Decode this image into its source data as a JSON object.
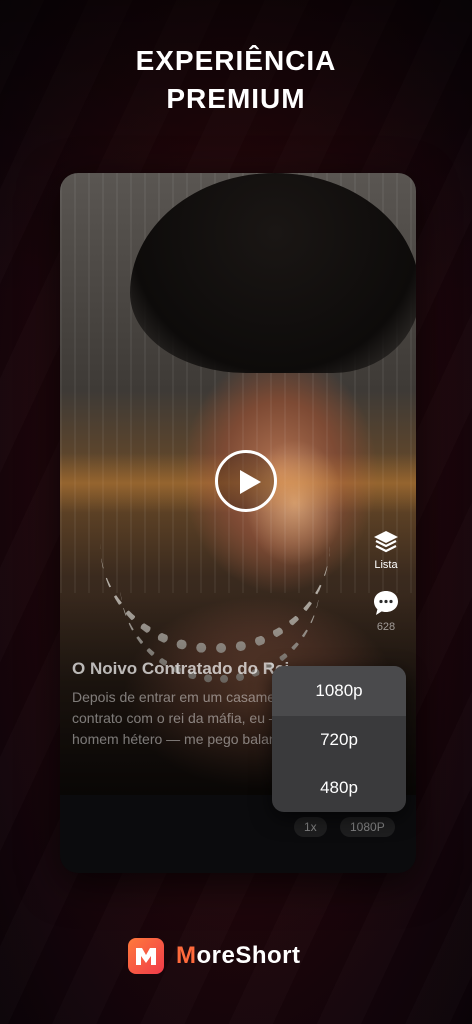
{
  "headline": {
    "line1": "EXPERIÊNCIA",
    "line2": "PREMIUM"
  },
  "player": {
    "play_icon": "play-icon",
    "side_actions": [
      {
        "icon": "layers-icon",
        "label": "Lista"
      },
      {
        "icon": "comment-icon",
        "label": "628"
      }
    ],
    "title": "O Noivo Contratado do Rei",
    "description_lines": [
      "Depois de entrar em um casamento",
      "contrato com o rei da máfia, eu —",
      "homem hétero — me pego balançando"
    ],
    "speed_chip": "1x",
    "quality_chip": "1080P"
  },
  "quality_menu": {
    "options": [
      "1080p",
      "720p",
      "480p"
    ],
    "selected": "1080p"
  },
  "brand": {
    "logo_icon": "moreshort-logo-icon",
    "name_first": "M",
    "name_rest": "oreShort",
    "accent_color": "#ff6a3c"
  }
}
